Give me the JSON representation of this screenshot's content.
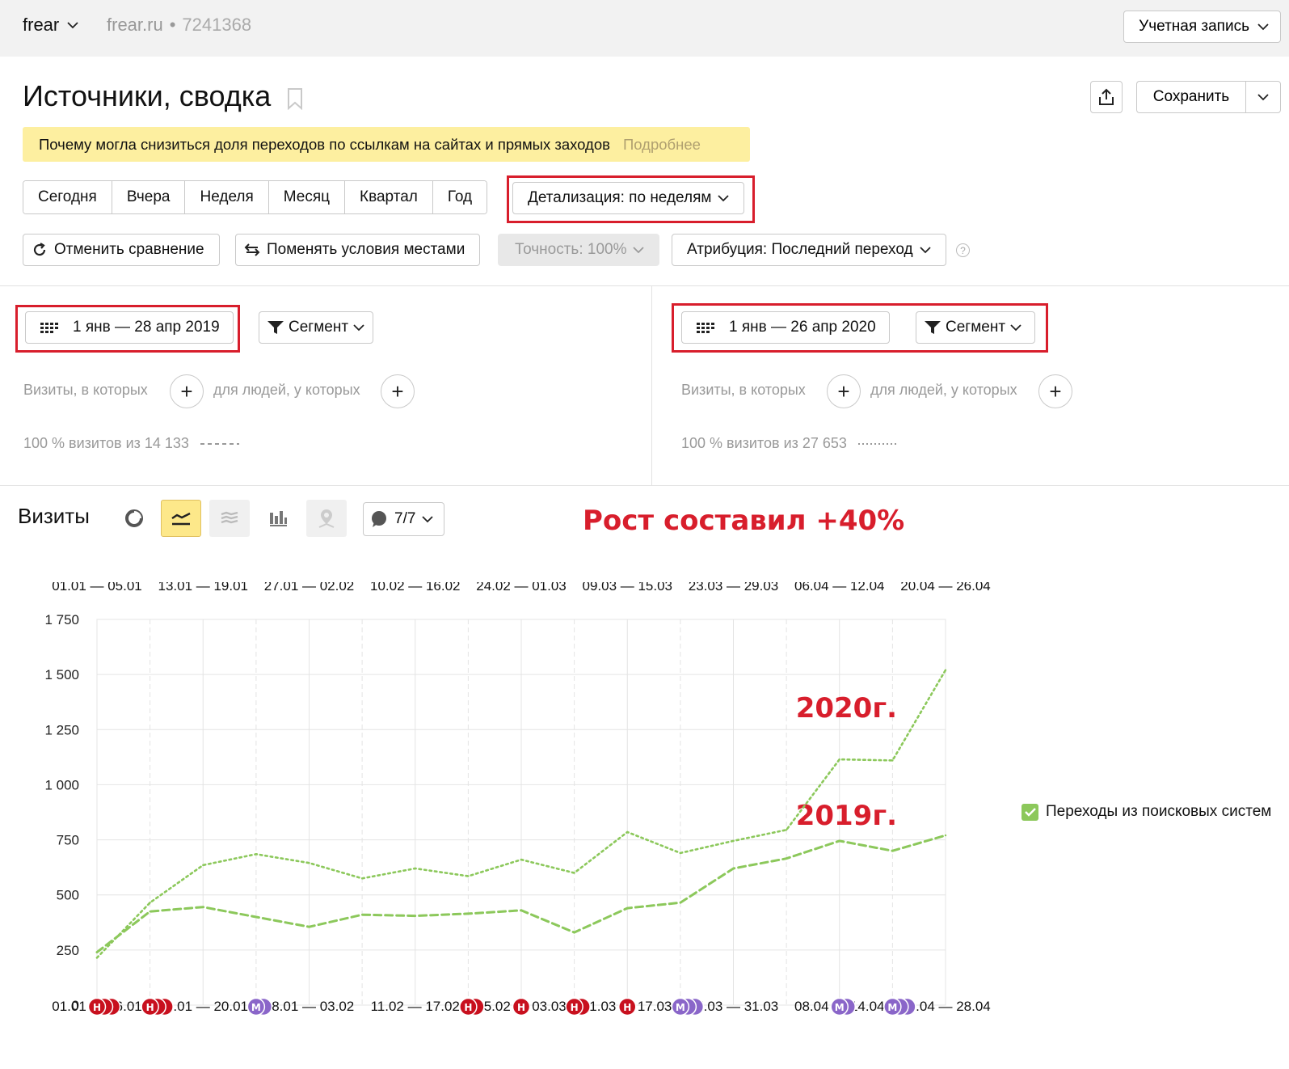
{
  "topbar": {
    "counter_name": "frear",
    "site": "frear.ru",
    "separator": "•",
    "counter_id": "7241368",
    "account_label": "Учетная запись"
  },
  "header": {
    "title": "Источники, сводка",
    "save_label": "Сохранить"
  },
  "notice": {
    "text": "Почему могла снизиться доля переходов по ссылкам на сайтах и прямых заходов",
    "link": "Подробнее"
  },
  "periods": [
    "Сегодня",
    "Вчера",
    "Неделя",
    "Месяц",
    "Квартал",
    "Год"
  ],
  "detail_label": "Детализация: по неделям",
  "controls": {
    "cancel_compare": "Отменить сравнение",
    "swap": "Поменять условия местами",
    "accuracy": "Точность: 100%",
    "attribution": "Атрибуция: Последний переход",
    "help": "?"
  },
  "segments": {
    "left": {
      "date_range": "1 янв — 28 апр 2019",
      "segment_label": "Сегмент",
      "visits_cond": "Визиты, в которых",
      "people_cond": "для людей, у которых",
      "share": "100 % визитов из 14 133"
    },
    "right": {
      "date_range": "1 янв — 26 апр 2020",
      "segment_label": "Сегмент",
      "visits_cond": "Визиты, в которых",
      "people_cond": "для людей, у которых",
      "share": "100 % визитов из 27 653"
    }
  },
  "chart_panel": {
    "title": "Визиты",
    "notes_label": "7/7",
    "growth_annotation": "Рост составил +40%"
  },
  "colors": {
    "accent_red": "#d81e2c",
    "series_green": "#8cc85b",
    "note_red": "#c8101e",
    "note_purple": "#8a66c9"
  },
  "chart_data": {
    "type": "line",
    "top_ticks": [
      "01.01 — 05.01",
      "13.01 — 19.01",
      "27.01 — 02.02",
      "10.02 — 16.02",
      "24.02 — 01.03",
      "09.03 — 15.03",
      "23.03 — 29.03",
      "06.04 — 12.04",
      "20.04 — 26.04"
    ],
    "bottom_ticks": [
      "01.01 — 06.01",
      "14.01 — 20.01",
      "28.01 — 03.02",
      "11.02 — 17.02",
      "25.02 — 03.03",
      "11.03 — 17.03",
      "25.03 — 31.03",
      "08.04 — 14.04",
      "22.04 — 28.04"
    ],
    "y_ticks": [
      "0",
      "250",
      "500",
      "750",
      "1 000",
      "1 250",
      "1 500",
      "1 750"
    ],
    "ylim": [
      0,
      1750
    ],
    "grid": true,
    "legend": {
      "label": "Переходы из поисковых систем",
      "position": "right"
    },
    "series": [
      {
        "name": "2019г.",
        "style": "dashed",
        "values": [
          240,
          425,
          445,
          400,
          355,
          410,
          405,
          415,
          430,
          330,
          440,
          465,
          620,
          665,
          745,
          700,
          770
        ]
      },
      {
        "name": "2020г.",
        "style": "dotted",
        "values": [
          215,
          465,
          635,
          685,
          645,
          575,
          620,
          585,
          660,
          600,
          785,
          690,
          745,
          795,
          1115,
          1110,
          1520
        ]
      }
    ],
    "notes": [
      {
        "index": 0,
        "letter": "Н",
        "type": "red",
        "count": 3
      },
      {
        "index": 1,
        "letter": "Н",
        "type": "red",
        "count": 3
      },
      {
        "index": 3,
        "letter": "М",
        "type": "purple",
        "count": 2
      },
      {
        "index": 7,
        "letter": "Н",
        "type": "red",
        "count": 2
      },
      {
        "index": 8,
        "letter": "Н",
        "type": "red",
        "count": 1
      },
      {
        "index": 9,
        "letter": "Н",
        "type": "red",
        "count": 2
      },
      {
        "index": 10,
        "letter": "Н",
        "type": "red",
        "count": 1
      },
      {
        "index": 11,
        "letter": "М",
        "type": "purple",
        "count": 3
      },
      {
        "index": 14,
        "letter": "М",
        "type": "purple",
        "count": 2
      },
      {
        "index": 15,
        "letter": "М",
        "type": "purple",
        "count": 3
      }
    ]
  }
}
